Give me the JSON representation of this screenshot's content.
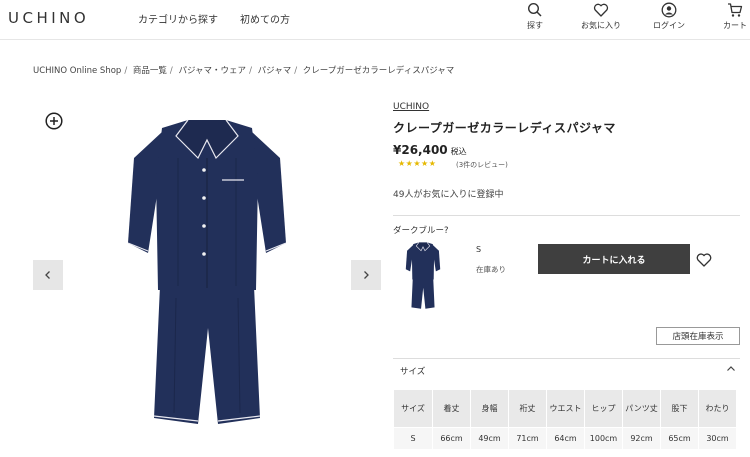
{
  "header": {
    "logo": "UCHINO",
    "nav": [
      {
        "label": "カテゴリから探す"
      },
      {
        "label": "初めての方"
      }
    ],
    "icons": [
      {
        "icon": "search-icon",
        "label": "探す"
      },
      {
        "icon": "heart-icon",
        "label": "お気に入り"
      },
      {
        "icon": "user-icon",
        "label": "ログイン"
      },
      {
        "icon": "cart-icon",
        "label": "カート"
      }
    ]
  },
  "breadcrumb": [
    "UCHINO Online Shop",
    "商品一覧",
    "パジャマ・ウェア",
    "パジャマ",
    "クレープガーゼカラーレディスパジャマ"
  ],
  "product": {
    "brand": "UCHINO",
    "title": "クレープガーゼカラーレディスパジャマ",
    "price": "¥26,400",
    "tax": "税込",
    "stars": "★★★★★",
    "reviews": "(3件のレビュー)",
    "favorites": "49人がお気に入りに登録中",
    "color_label": "ダークブルー?",
    "variant": {
      "size": "S",
      "stock": "在庫あり"
    },
    "cart_button": "カートに入れる",
    "store_stock_button": "店頭在庫表示",
    "size_section": "サイズ",
    "color": "#22305a"
  },
  "size_table": {
    "headers": [
      "サイズ",
      "着丈",
      "身幅",
      "裄丈",
      "ウエスト",
      "ヒップ",
      "パンツ丈",
      "股下",
      "わたり"
    ],
    "rows": [
      [
        "S",
        "66cm",
        "49cm",
        "71cm",
        "64cm",
        "100cm",
        "92cm",
        "65cm",
        "30cm"
      ]
    ]
  }
}
